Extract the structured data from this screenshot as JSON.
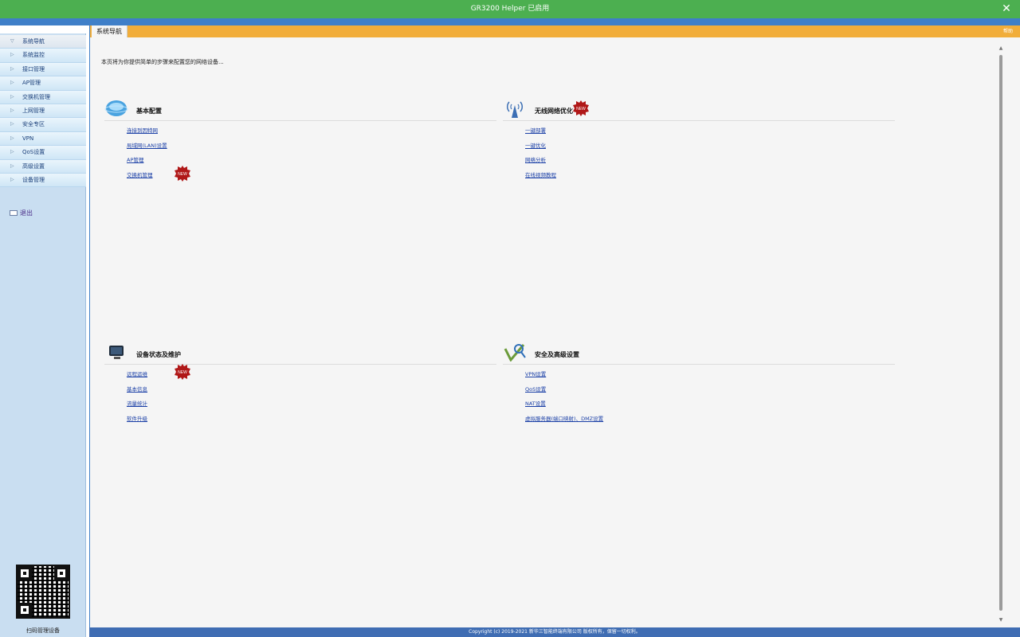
{
  "window": {
    "title": "GR3200 Helper 已启用",
    "close_icon": "close-icon"
  },
  "sidebar": {
    "items": [
      {
        "label": "系统导航",
        "active": true
      },
      {
        "label": "系统监控"
      },
      {
        "label": "接口管理"
      },
      {
        "label": "AP管理"
      },
      {
        "label": "交换机管理"
      },
      {
        "label": "上网管理"
      },
      {
        "label": "安全专区"
      },
      {
        "label": "VPN"
      },
      {
        "label": "QoS设置"
      },
      {
        "label": "高级设置"
      },
      {
        "label": "设备管理"
      }
    ],
    "logout": "退出",
    "qr_label": "扫码管理设备"
  },
  "main": {
    "tab": "系统导航",
    "help": "帮助",
    "intro": "本页将为你提供简单的步骤来配置您的网络设备...",
    "sections": {
      "basic": {
        "title": "基本配置",
        "links": [
          "连接到因特网",
          "局域网(LAN)设置",
          "AP管理",
          "交换机管理"
        ]
      },
      "wireless": {
        "title": "无线网络优化",
        "links": [
          "一键部署",
          "一键优化",
          "网络分析",
          "在线视频教程"
        ]
      },
      "status": {
        "title": "设备状态及维护",
        "links": [
          "远程运维",
          "基本信息",
          "流量统计",
          "软件升级"
        ]
      },
      "security": {
        "title": "安全及高级设置",
        "links": [
          "VPN设置",
          "QoS设置",
          "NAT设置",
          "虚拟服务器(端口映射)、DMZ设置"
        ]
      }
    },
    "badge_text": "NEW"
  },
  "footer": "Copyright (c) 2019-2021 新华三智能终端有限公司 版权所有，保留一切权利。",
  "colors": {
    "titlebar": "#4caf50",
    "tabbar": "#f1ad3a",
    "footer": "#3f6db3",
    "sidebar": "#c9def1"
  }
}
